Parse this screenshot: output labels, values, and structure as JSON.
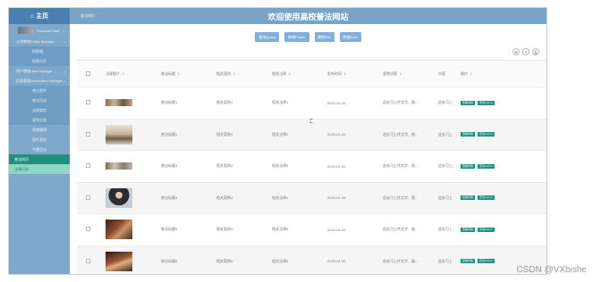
{
  "sidebar": {
    "logo": {
      "icon": "home-icon",
      "label": "主页"
    },
    "avatar_label": "Personal Data",
    "items": [
      {
        "label": "公共教育Public Manage",
        "type": "group"
      },
      {
        "label": "短视频",
        "type": "sub"
      },
      {
        "label": "短视分页",
        "type": "sub"
      },
      {
        "label": "用户管理User Manage",
        "type": "group"
      },
      {
        "label": "信息管理Information Manage",
        "type": "group"
      },
      {
        "label": "普法宣传",
        "type": "sub"
      },
      {
        "label": "普法活动",
        "type": "sub"
      },
      {
        "label": "法律类型",
        "type": "sub"
      },
      {
        "label": "案例分类",
        "type": "sub"
      },
      {
        "label": "系统管理",
        "type": "sub2"
      },
      {
        "label": "案件类别",
        "type": "sub2"
      },
      {
        "label": "专题活动",
        "type": "sub2"
      },
      {
        "label": "普法知识",
        "type": "active"
      },
      {
        "label": "法律问答",
        "type": "selected"
      }
    ]
  },
  "header": {
    "breadcrumb": "普法知识",
    "title": "欢迎使用高校普法网站"
  },
  "toolbar": {
    "buttons": [
      "查询Query",
      "新增Power",
      "删除Del",
      "数据Hold"
    ]
  },
  "table_tools": {
    "icons": [
      "filter-icon",
      "export-icon",
      "print-icon"
    ],
    "glyphs": [
      "⊞",
      "⇧",
      "⎙"
    ]
  },
  "table": {
    "headers": [
      "",
      "法规图片",
      "普法标题",
      "相关案例",
      "相关法律",
      "发布时间",
      "案例详情",
      "内容",
      "操作"
    ],
    "rows": [
      {
        "title": "普法标题1",
        "case": "相关案例1",
        "law": "相关法律1",
        "date": "2023-01-05",
        "detail": "此处可上传文字、图...",
        "content": "此处可上"
      },
      {
        "title": "普法标题2",
        "case": "相关案例2",
        "law": "相关法律2",
        "date": "2023-01-05",
        "detail": "此处可上传文字、图...",
        "content": "此处可上"
      },
      {
        "title": "普法标题3",
        "case": "相关案例3",
        "law": "相关法律3",
        "date": "2023-01-05",
        "detail": "此处可上传文字、图...",
        "content": "此处可上"
      },
      {
        "title": "普法标题4",
        "case": "相关案例4",
        "law": "相关法律4",
        "date": "2023-01-05",
        "detail": "此处可上传文字、图...",
        "content": "此处可上"
      },
      {
        "title": "普法标题5",
        "case": "相关案例5",
        "law": "相关法律5",
        "date": "2023-01-05",
        "detail": "此处可上传文字、图...",
        "content": "此处可上"
      },
      {
        "title": "普法标题6",
        "case": "相关案例6",
        "law": "相关法律6",
        "date": "2023-01-05",
        "detail": "此处可上传文字、图...",
        "content": "此处可上"
      }
    ],
    "action_view": "查看详情",
    "action_comment": "评论Forum"
  },
  "watermark": "CSDN @VXbishe",
  "colors": {
    "sidebar": "#7fa7c9",
    "header": "#7aa3c8",
    "accent": "#1f8f7e",
    "button": "#7fb0dc"
  }
}
